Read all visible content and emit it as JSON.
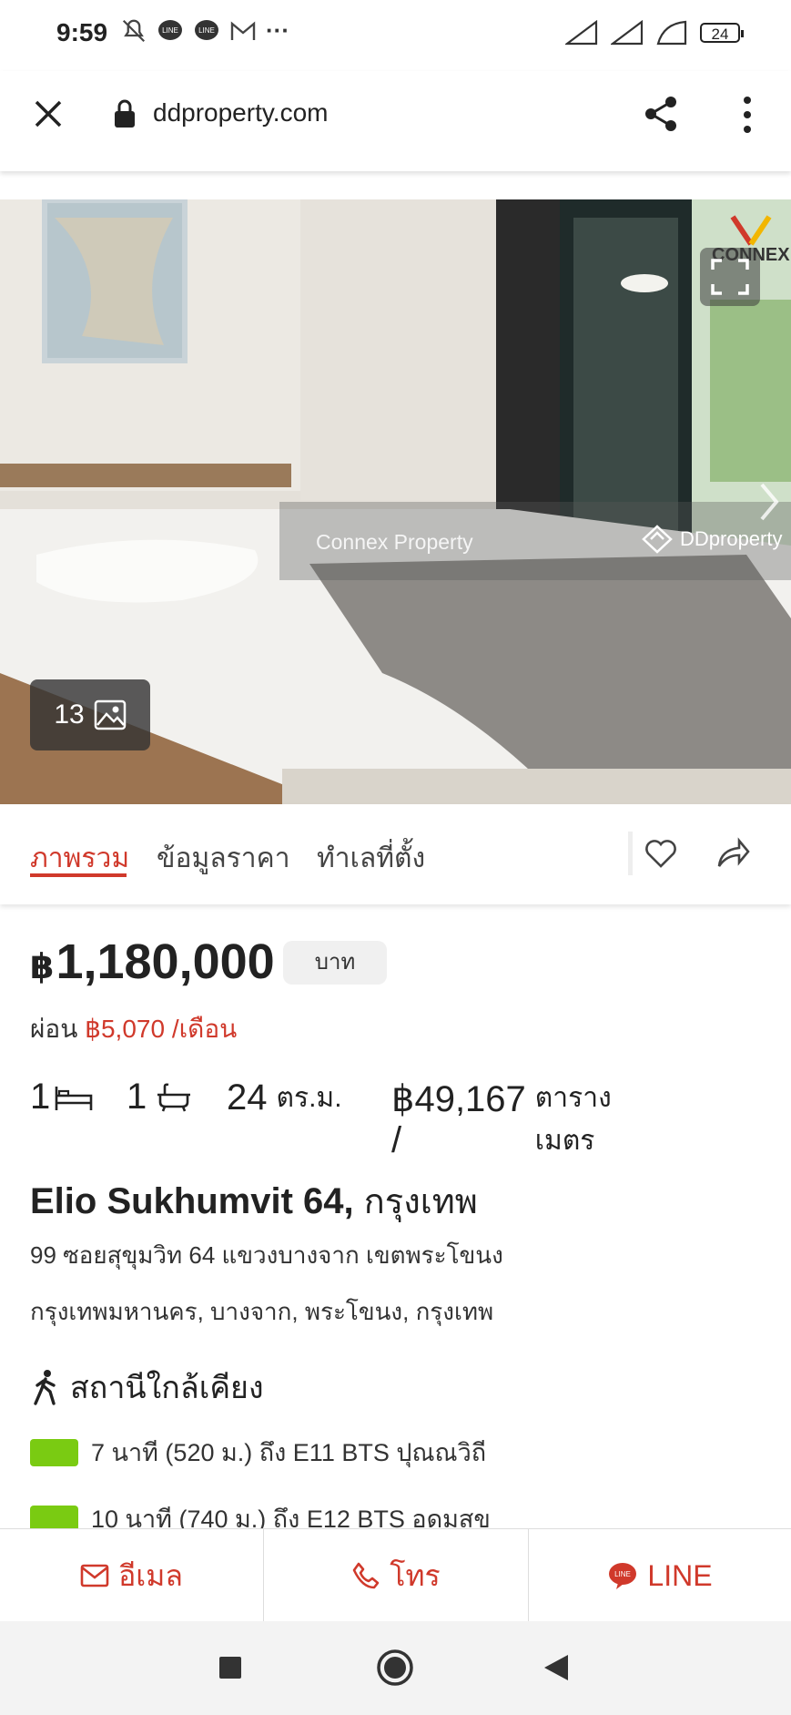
{
  "status_bar": {
    "time": "9:59",
    "battery": "24"
  },
  "browser": {
    "url": "ddproperty.com"
  },
  "gallery": {
    "photo_count": "13",
    "watermark_text": "Connex Property",
    "watermark_brand": "DDproperty",
    "connex_logo": "CONNEX"
  },
  "tabs": [
    {
      "label": "ภาพรวม",
      "active": true
    },
    {
      "label": "ข้อมูลราคา",
      "active": false
    },
    {
      "label": "ทำเลที่ตั้ง",
      "active": false
    }
  ],
  "listing": {
    "currency_symbol": "฿",
    "price": "1,180,000",
    "price_unit": "บาท",
    "installment_label": "ผ่อน",
    "installment_amount": "฿5,070 /เดือน",
    "bedrooms": "1",
    "bathrooms": "1",
    "area_value": "24",
    "area_unit": "ตร.ม.",
    "price_per_sqm": "฿49,167 /",
    "price_per_sqm_unit": "ตารางเมตร",
    "title": "Elio Sukhumvit 64,",
    "title_city": "กรุงเทพ",
    "address_line1": "99 ซอยสุขุมวิท 64 แขวงบางจาก เขตพระโขนง",
    "address_line2": "กรุงเทพมหานคร, บางจาก, พระโขนง, กรุงเทพ"
  },
  "stations": {
    "heading": "สถานีใกล้เคียง",
    "items": [
      {
        "text": "7 นาที (520 ม.) ถึง E11 BTS ปุณณวิถี",
        "line_color": "#7acb12"
      },
      {
        "text": "10 นาที (740 ม.) ถึง E12 BTS อุดมสุข",
        "line_color": "#7acb12"
      }
    ]
  },
  "actions": {
    "email": "อีเมล",
    "call": "โทร",
    "line": "LINE"
  },
  "colors": {
    "accent": "#d0392b",
    "bts": "#7acb12"
  }
}
